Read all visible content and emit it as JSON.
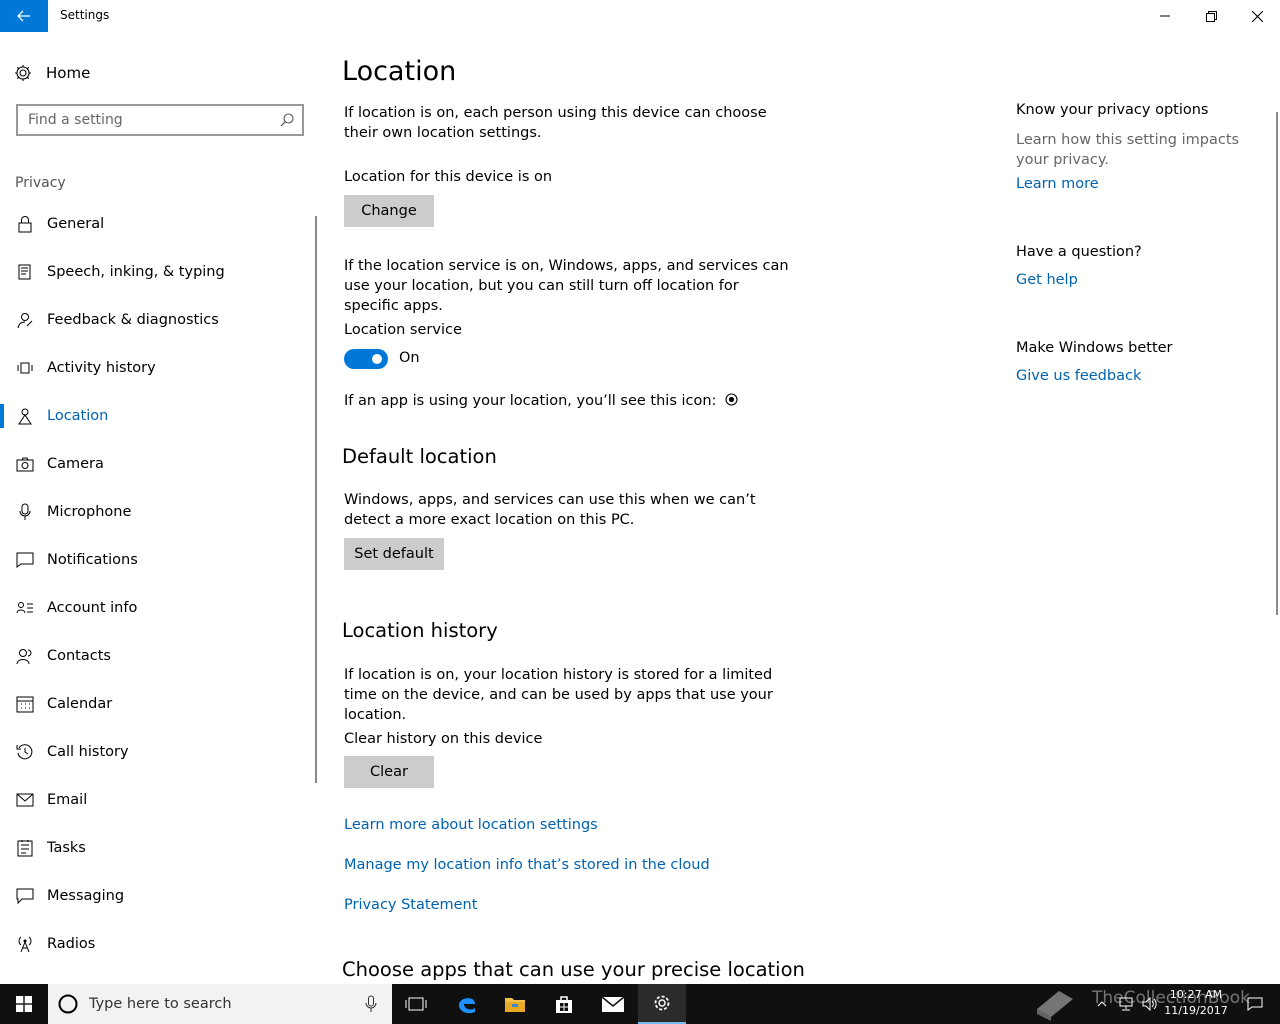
{
  "window": {
    "title": "Settings"
  },
  "sidebar": {
    "home_label": "Home",
    "search_placeholder": "Find a setting",
    "section_label": "Privacy",
    "items": [
      {
        "label": "General",
        "icon": "lock-icon"
      },
      {
        "label": "Speech, inking, & typing",
        "icon": "speech-icon"
      },
      {
        "label": "Feedback & diagnostics",
        "icon": "feedback-icon"
      },
      {
        "label": "Activity history",
        "icon": "activity-history-icon"
      },
      {
        "label": "Location",
        "icon": "location-icon",
        "active": true
      },
      {
        "label": "Camera",
        "icon": "camera-icon"
      },
      {
        "label": "Microphone",
        "icon": "microphone-icon"
      },
      {
        "label": "Notifications",
        "icon": "notifications-icon"
      },
      {
        "label": "Account info",
        "icon": "account-info-icon"
      },
      {
        "label": "Contacts",
        "icon": "contacts-icon"
      },
      {
        "label": "Calendar",
        "icon": "calendar-icon"
      },
      {
        "label": "Call history",
        "icon": "call-history-icon"
      },
      {
        "label": "Email",
        "icon": "email-icon"
      },
      {
        "label": "Tasks",
        "icon": "tasks-icon"
      },
      {
        "label": "Messaging",
        "icon": "messaging-icon"
      },
      {
        "label": "Radios",
        "icon": "radios-icon"
      }
    ]
  },
  "main": {
    "title": "Location",
    "intro": "If location is on, each person using this device can choose their own location settings.",
    "device_status": "Location for this device is on",
    "change_button": "Change",
    "service_desc": "If the location service is on, Windows, apps, and services can use your location, but you can still turn off location for specific apps.",
    "service_label": "Location service",
    "service_toggle_state": "On",
    "icon_note": "If an app is using your location, you’ll see this icon:",
    "default_heading": "Default location",
    "default_desc": "Windows, apps, and services can use this when we can’t detect a more exact location on this PC.",
    "set_default_button": "Set default",
    "history_heading": "Location history",
    "history_desc": "If location is on, your location history is stored for a limited time on the device, and can be used by apps that use your location.",
    "clear_label": "Clear history on this device",
    "clear_button": "Clear",
    "link_learn_more": "Learn more about location settings",
    "link_manage_cloud": "Manage my location info that’s stored in the cloud",
    "link_privacy": "Privacy Statement",
    "apps_heading": "Choose apps that can use your precise location"
  },
  "right_panel": {
    "privacy_heading": "Know your privacy options",
    "privacy_desc": "Learn how this setting impacts your privacy.",
    "learn_more": "Learn more",
    "question_heading": "Have a question?",
    "get_help": "Get help",
    "better_heading": "Make Windows better",
    "feedback_link": "Give us feedback"
  },
  "taskbar": {
    "search_placeholder": "Type here to search",
    "time": "10:27 AM",
    "date": "11/19/2017",
    "watermark": "TheCollectionBook"
  },
  "colors": {
    "accent": "#0078d7",
    "link": "#0063b1",
    "button_gray": "#cccccc"
  }
}
